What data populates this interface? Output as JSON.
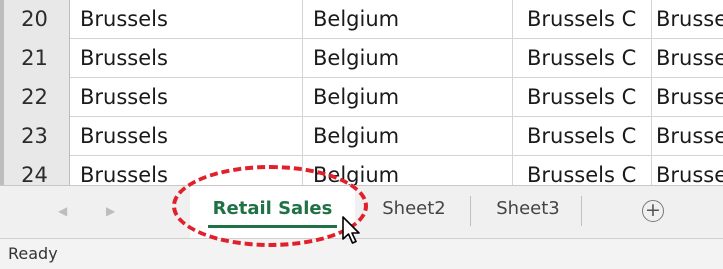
{
  "rows": [
    {
      "num": "20",
      "city": "Brussels",
      "country": "Belgium",
      "c3": "Brussels C",
      "c4": "Brussels"
    },
    {
      "num": "21",
      "city": "Brussels",
      "country": "Belgium",
      "c3": "Brussels C",
      "c4": "Brussels"
    },
    {
      "num": "22",
      "city": "Brussels",
      "country": "Belgium",
      "c3": "Brussels C",
      "c4": "Brussels"
    },
    {
      "num": "23",
      "city": "Brussels",
      "country": "Belgium",
      "c3": "Brussels C",
      "c4": "Brussels"
    },
    {
      "num": "24",
      "city": "Brussels",
      "country": "Belgium",
      "c3": "Brussels C",
      "c4": "Brussels"
    }
  ],
  "tabs": {
    "nav_prev": "◀",
    "nav_next": "▶",
    "active": "Retail Sales",
    "sheet2": "Sheet2",
    "sheet3": "Sheet3",
    "add": "+"
  },
  "status": {
    "text": "Ready"
  },
  "colors": {
    "accent": "#207245",
    "highlight": "#e0202a"
  },
  "icons": {
    "add": "plus-circle-icon",
    "cursor": "mouse-pointer-icon"
  }
}
